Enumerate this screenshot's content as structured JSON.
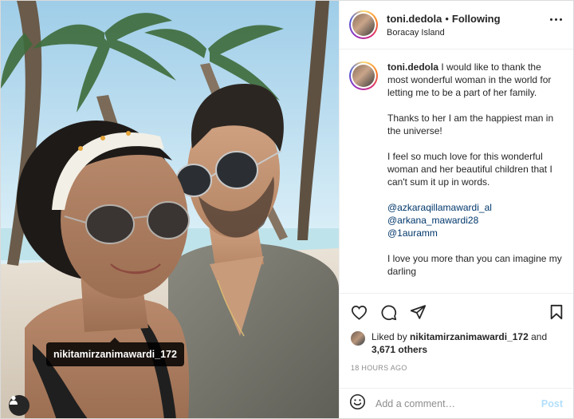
{
  "photo": {
    "tag_label": "nikitamirzanimawardi_172",
    "tag_icon": "person-tag-icon"
  },
  "header": {
    "username": "toni.dedola",
    "separator": "•",
    "follow_status": "Following",
    "location": "Boracay Island",
    "more_icon": "more-options-icon"
  },
  "caption": {
    "username": "toni.dedola",
    "paragraph1": "I would like to thank the most wonderful woman in the world for letting me to be a part of her family.",
    "paragraph2": "Thanks to her I am the happiest man in the universe!",
    "paragraph3": "I feel so much love for this wonderful woman and her beautiful children that I can't sum it up in words.",
    "mentions": [
      "@azkaraqillamawardi_al",
      "@arkana_mawardi28",
      "@1auramm"
    ],
    "paragraph4": "I love you more than you can imagine my darling"
  },
  "actions": {
    "icons": [
      "heart-icon",
      "comment-icon",
      "share-icon",
      "bookmark-icon"
    ]
  },
  "likes": {
    "prefix": "Liked by",
    "user": "nikitamirzanimawardi_172",
    "and": "and",
    "others": "3,671 others"
  },
  "timestamp": "18 HOURS AGO",
  "comment_box": {
    "placeholder": "Add a comment…",
    "post_label": "Post",
    "emoji_icon": "emoji-icon"
  },
  "colors": {
    "link": "#00376b",
    "muted": "#8e8e8e",
    "post_disabled": "#b2dffc",
    "text": "#262626"
  }
}
